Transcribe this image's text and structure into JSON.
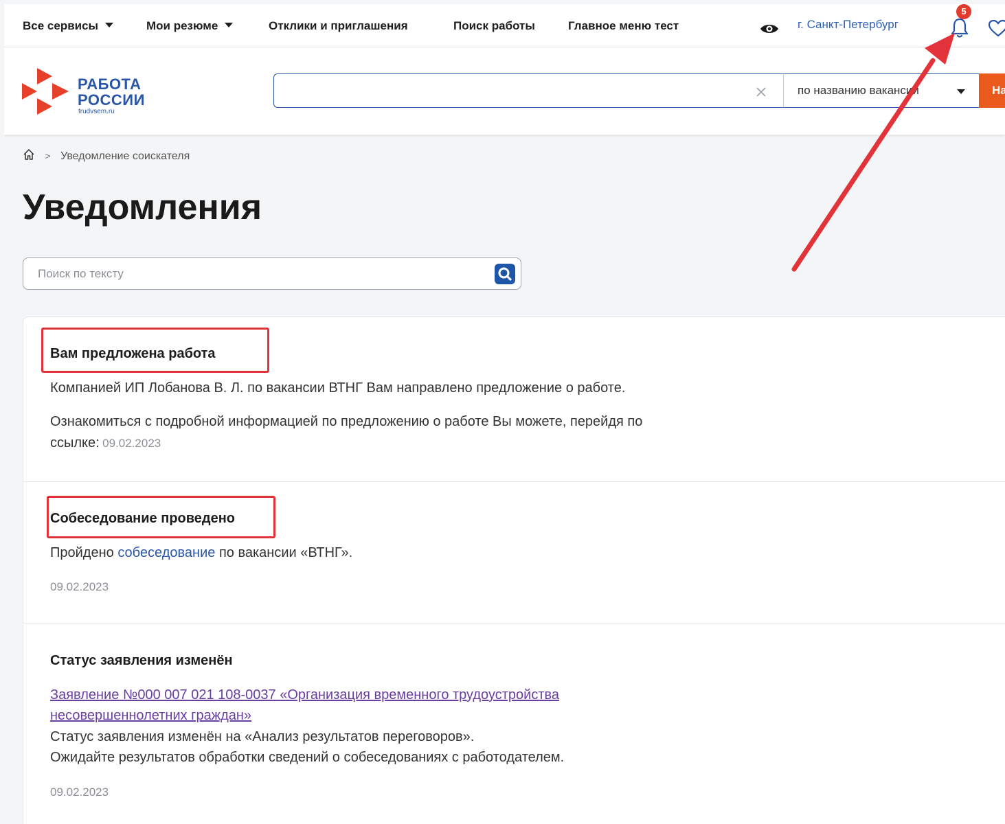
{
  "topnav": {
    "items": [
      {
        "label": "Все сервисы"
      },
      {
        "label": "Мои резюме"
      },
      {
        "label": "Отклики и приглашения"
      },
      {
        "label": "Поиск работы"
      },
      {
        "label": "Главное меню тест"
      }
    ],
    "city": "г. Санкт-Петербург",
    "notifications_count": "5"
  },
  "header": {
    "logo_title_line1": "РАБОТА",
    "logo_title_line2": "РОССИИ",
    "logo_subtitle": "trudvsem.ru",
    "search_value": "",
    "search_type": "по названию вакансии",
    "find_button": "Найти"
  },
  "breadcrumb": {
    "separator": ">",
    "current": "Уведомление соискателя"
  },
  "page_title": "Уведомления",
  "text_search": {
    "placeholder": "Поиск по тексту"
  },
  "notifications": [
    {
      "title": "Вам предложена работа",
      "line1": "Компанией ИП Лобанова В. Л. по вакансии ВТНГ Вам направлено предложение о работе.",
      "line2_part1": "Ознакомиться с подробной информацией по предложению о работе Вы можете, перейдя по",
      "line2_part2": "ссылке:",
      "date": "09.02.2023"
    },
    {
      "title": "Собеседование проведено",
      "text_prefix": "Пройдено",
      "link": "собеседование",
      "text_suffix": "по вакансии «ВТНГ».",
      "date": "09.02.2023"
    },
    {
      "title": "Статус заявления изменён",
      "link_line1": "Заявление №000 007 021 108-0037 «Организация временного трудоустройства",
      "link_line2": "несовершеннолетних граждан»",
      "line1": "Статус заявления изменён на «Анализ результатов переговоров».",
      "line2": "Ожидайте результатов обработки сведений о собеседованиях с работодателем.",
      "date": "09.02.2023"
    }
  ],
  "colors": {
    "brand_blue": "#2a56a8",
    "accent_orange": "#ea5a1c",
    "highlight_red": "#e3333a"
  }
}
